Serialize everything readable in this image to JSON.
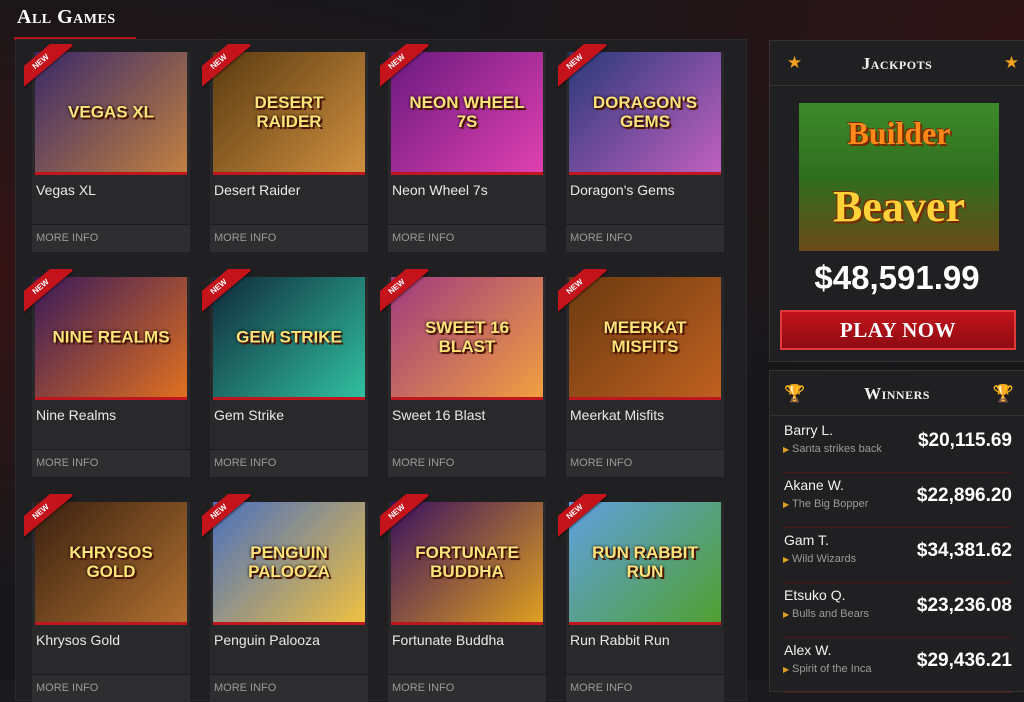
{
  "section": {
    "title": "All Games"
  },
  "ribbon_label": "NEW",
  "more_info_label": "MORE INFO",
  "games": [
    {
      "name": "Vegas XL",
      "art": "Vegas XL",
      "colors": [
        "#3a2a6a",
        "#c08040"
      ]
    },
    {
      "name": "Desert Raider",
      "art": "Desert Raider",
      "colors": [
        "#5a3a10",
        "#d09040"
      ]
    },
    {
      "name": "Neon Wheel 7s",
      "art": "Neon Wheel 7s",
      "colors": [
        "#6a1a80",
        "#e040b0"
      ]
    },
    {
      "name": "Doragon's Gems",
      "art": "Doragon's Gems",
      "colors": [
        "#2a3a7a",
        "#c060c0"
      ]
    },
    {
      "name": "Nine Realms",
      "art": "Nine Realms",
      "colors": [
        "#3a1a5a",
        "#e07020"
      ]
    },
    {
      "name": "Gem Strike",
      "art": "Gem Strike",
      "colors": [
        "#102a3a",
        "#30c0a0"
      ]
    },
    {
      "name": "Sweet 16 Blast",
      "art": "Sweet 16 Blast",
      "colors": [
        "#a03a80",
        "#f0a040"
      ]
    },
    {
      "name": "Meerkat Misfits",
      "art": "Meerkat Misfits",
      "colors": [
        "#6a3a10",
        "#c06020"
      ]
    },
    {
      "name": "Khrysos Gold",
      "art": "Khrysos Gold",
      "colors": [
        "#3a2010",
        "#b07030"
      ]
    },
    {
      "name": "Penguin Palooza",
      "art": "Penguin Palooza",
      "colors": [
        "#4a70c0",
        "#f0c040"
      ]
    },
    {
      "name": "Fortunate Buddha",
      "art": "Fortunate Buddha",
      "colors": [
        "#3a1060",
        "#e0a020"
      ]
    },
    {
      "name": "Run Rabbit Run",
      "art": "Run Rabbit Run",
      "colors": [
        "#60a0e0",
        "#50a030"
      ]
    }
  ],
  "jackpots": {
    "title": "Jackpots",
    "game_art_line1": "Builder",
    "game_art_line2": "Beaver",
    "amount": "$48,591.99",
    "play_label": "PLAY NOW"
  },
  "winners": {
    "title": "Winners",
    "items": [
      {
        "name": "Barry L.",
        "game": "Santa strikes back",
        "amount": "$20,115.69"
      },
      {
        "name": "Akane W.",
        "game": "The Big Bopper",
        "amount": "$22,896.20"
      },
      {
        "name": "Gam T.",
        "game": "Wild Wizards",
        "amount": "$34,381.62"
      },
      {
        "name": "Etsuko Q.",
        "game": "Bulls and Bears",
        "amount": "$23,236.08"
      },
      {
        "name": "Alex W.",
        "game": "Spirit of the Inca",
        "amount": "$29,436.21"
      }
    ]
  }
}
